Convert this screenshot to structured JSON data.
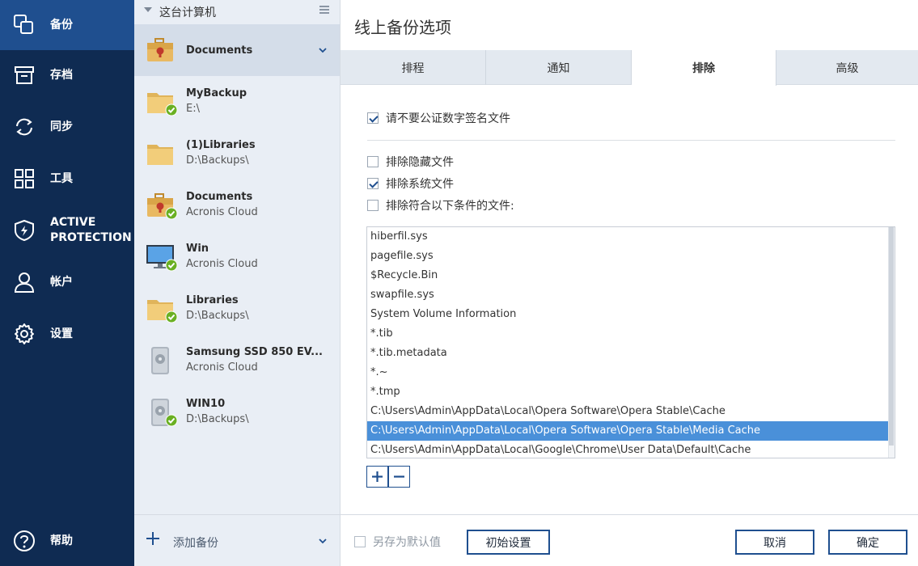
{
  "nav": {
    "items": [
      {
        "label": "备份",
        "icon": "backup-icon"
      },
      {
        "label": "存档",
        "icon": "archive-icon"
      },
      {
        "label": "同步",
        "icon": "sync-icon"
      },
      {
        "label": "工具",
        "icon": "tools-icon"
      },
      {
        "label": "ACTIVE PROTECTION",
        "icon": "shield-icon"
      },
      {
        "label": "帐户",
        "icon": "account-icon"
      },
      {
        "label": "设置",
        "icon": "gear-icon"
      }
    ],
    "help_label": "帮助",
    "active_color": "#1f4f8f",
    "background_color": "#0f2b52"
  },
  "backup_list": {
    "header_title": "这台计算机",
    "items": [
      {
        "name": "Documents",
        "destination": "",
        "icon": "briefcase-icon",
        "status": "none",
        "selected": true
      },
      {
        "name": "MyBackup",
        "destination": "E:\\",
        "icon": "folder-icon",
        "status": "ok"
      },
      {
        "name": "(1)Libraries",
        "destination": "D:\\Backups\\",
        "icon": "folder-icon",
        "status": "none"
      },
      {
        "name": "Documents",
        "destination": "Acronis Cloud",
        "icon": "briefcase-icon",
        "status": "ok"
      },
      {
        "name": "Win",
        "destination": "Acronis Cloud",
        "icon": "monitor-icon",
        "status": "ok"
      },
      {
        "name": "Libraries",
        "destination": "D:\\Backups\\",
        "icon": "folder-icon",
        "status": "ok"
      },
      {
        "name": "Samsung SSD 850 EV...",
        "destination": "Acronis Cloud",
        "icon": "disk-icon",
        "status": "none"
      },
      {
        "name": "WIN10",
        "destination": "D:\\Backups\\",
        "icon": "disk-icon",
        "status": "ok"
      }
    ],
    "add_label": "添加备份",
    "ok_color": "#6ab023"
  },
  "panel": {
    "title": "线上备份选项",
    "tabs": [
      {
        "label": "排程",
        "active": false
      },
      {
        "label": "通知",
        "active": false
      },
      {
        "label": "排除",
        "active": true
      },
      {
        "label": "高级",
        "active": false
      }
    ],
    "options": [
      {
        "label": "请不要公证数字签名文件",
        "checked": true
      },
      {
        "label": "排除隐藏文件",
        "checked": false
      },
      {
        "label": "排除系统文件",
        "checked": true
      },
      {
        "label": "排除符合以下条件的文件:",
        "checked": false
      }
    ],
    "exclusions": [
      "hiberfil.sys",
      "pagefile.sys",
      "$Recycle.Bin",
      "swapfile.sys",
      "System Volume Information",
      "*.tib",
      "*.tib.metadata",
      "*.~",
      "*.tmp",
      "C:\\Users\\Admin\\AppData\\Local\\Opera Software\\Opera Stable\\Cache",
      "C:\\Users\\Admin\\AppData\\Local\\Opera Software\\Opera Stable\\Media Cache",
      "C:\\Users\\Admin\\AppData\\Local\\Google\\Chrome\\User Data\\Default\\Cache"
    ],
    "selected_exclusion": "C:\\Users\\Admin\\AppData\\Local\\Opera Software\\Opera Stable\\Media Cache",
    "selection_color": "#4a90d9",
    "save_default_label": "另存为默认值",
    "reset_label": "初始设置",
    "cancel_label": "取消",
    "ok_label": "确定"
  }
}
